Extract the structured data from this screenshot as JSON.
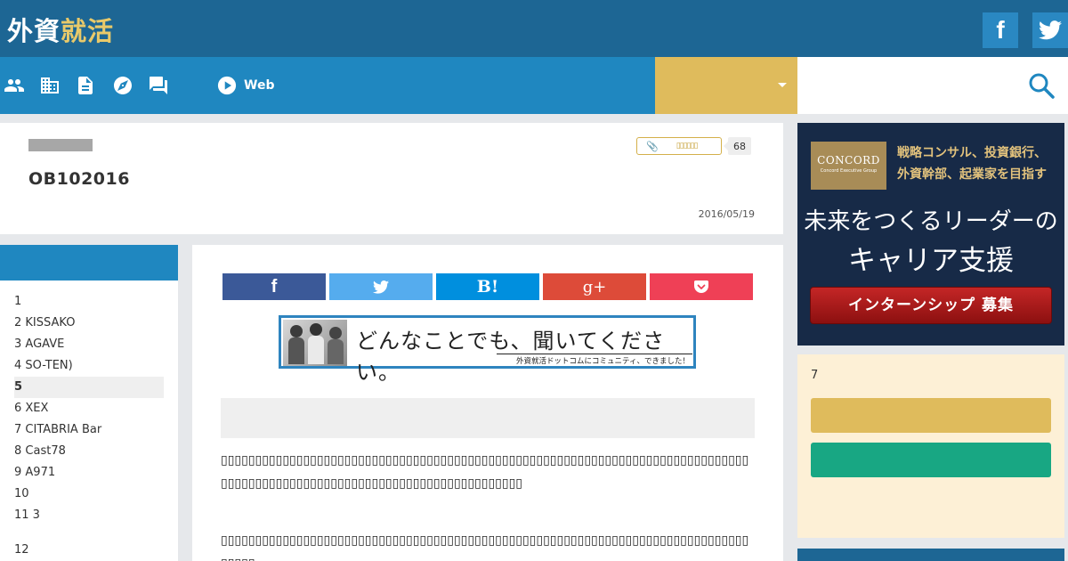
{
  "brand": {
    "logo_part1": "外資",
    "logo_part2": "就活"
  },
  "header_social": {
    "facebook_glyph": "f"
  },
  "nav": {
    "icons": [
      "people-icon",
      "building-icon",
      "document-icon",
      "compass-icon",
      "chat-icon"
    ],
    "web_label": "Web"
  },
  "article": {
    "title": "OB102016",
    "tag_text": "▯▯▯▯▯▯",
    "tag_count": "68",
    "date": "2016/05/19"
  },
  "toc": {
    "items": [
      "1",
      "2 KISSAKO",
      "3 AGAVE",
      "4 SO-TEN)",
      "5",
      "6 XEX",
      "7  CITABRIA Bar",
      "8 Cast78",
      "9 A971",
      "10",
      "11 3"
    ],
    "items_after_gap": [
      "12"
    ],
    "active_index": 4
  },
  "share": {
    "buttons": [
      {
        "name": "facebook",
        "color": "#3b5998",
        "glyph": "f"
      },
      {
        "name": "twitter",
        "color": "#55acee",
        "glyph": ""
      },
      {
        "name": "hatena",
        "color": "#008fde",
        "glyph": "B!"
      },
      {
        "name": "google-plus",
        "color": "#dd4b39",
        "glyph": "g+"
      },
      {
        "name": "pocket",
        "color": "#ef4056",
        "glyph": ""
      }
    ]
  },
  "banner": {
    "main_text": "どんなことでも、聞いてください。",
    "sub_text": "外資就活ドットコムにコミュニティ、できました！"
  },
  "body": {
    "para1": "▯▯▯▯▯▯▯▯▯▯▯▯▯▯▯▯▯▯▯▯▯▯▯▯▯▯▯▯▯▯▯▯▯▯▯▯▯▯▯▯▯▯▯▯▯▯▯▯▯▯▯▯▯▯▯▯▯▯▯▯▯▯▯▯▯▯▯▯▯▯▯▯▯▯▯▯▯▯▯▯▯▯▯▯▯▯▯▯▯▯▯▯▯▯▯▯▯▯▯▯▯▯▯▯▯▯▯▯▯▯▯▯▯▯▯▯▯▯▯▯▯",
    "para2": "▯▯▯▯▯▯▯▯▯▯▯▯▯▯▯▯▯▯▯▯▯▯▯▯▯▯▯▯▯▯▯▯▯▯▯▯▯▯▯▯▯▯▯▯▯▯▯▯▯▯▯▯▯▯▯▯▯▯▯▯▯▯▯▯▯▯▯▯▯▯▯▯▯▯▯▯▯▯▯▯▯▯"
  },
  "ad": {
    "logo_name": "CONCORD",
    "logo_sub": "Concord Executive Group",
    "line1": "戦略コンサル、投資銀行、",
    "line2": "外資幹部、起業家を目指す",
    "big1": "未来をつくるリーダーの",
    "big2": "キャリア支援",
    "button": "インターンシップ 募集"
  },
  "widget2": {
    "title": "7"
  },
  "colors": {
    "header_dark": "#1d6694",
    "nav_blue": "#1f87c0",
    "gold": "#dfbb5c",
    "green": "#18a783",
    "cream": "#fdf0d6"
  }
}
